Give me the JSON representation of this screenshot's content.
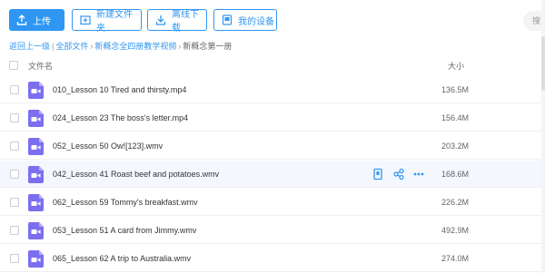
{
  "toolbar": {
    "upload": "上传",
    "new_folder": "新建文件夹",
    "offline_download": "离线下载",
    "my_devices": "我的设备",
    "search_placeholder": "搜"
  },
  "breadcrumb": {
    "back": "返回上一级",
    "all_files": "全部文件",
    "parent": "新概念全四册教学视频",
    "current": "新概念第一册"
  },
  "columns": {
    "name": "文件名",
    "size": "大小"
  },
  "files": [
    {
      "name": "010_Lesson 10 Tired and thirsty.mp4",
      "size": "136.5M"
    },
    {
      "name": "024_Lesson 23 The boss's letter.mp4",
      "size": "156.4M"
    },
    {
      "name": "052_Lesson 50 Ow![123].wmv",
      "size": "203.2M"
    },
    {
      "name": "042_Lesson 41 Roast beef and potatoes.wmv",
      "size": "168.6M"
    },
    {
      "name": "062_Lesson 59 Tommy's breakfast.wmv",
      "size": "226.2M"
    },
    {
      "name": "053_Lesson 51 A card from Jimmy.wmv",
      "size": "492.9M"
    },
    {
      "name": "065_Lesson 62 A trip to Australia.wmv",
      "size": "274.0M"
    }
  ],
  "row_actions": [
    "share-link-icon",
    "share-icon",
    "more-icon"
  ],
  "colors": {
    "accent": "#2f96f2",
    "video_icon": "#7b6ff0"
  }
}
